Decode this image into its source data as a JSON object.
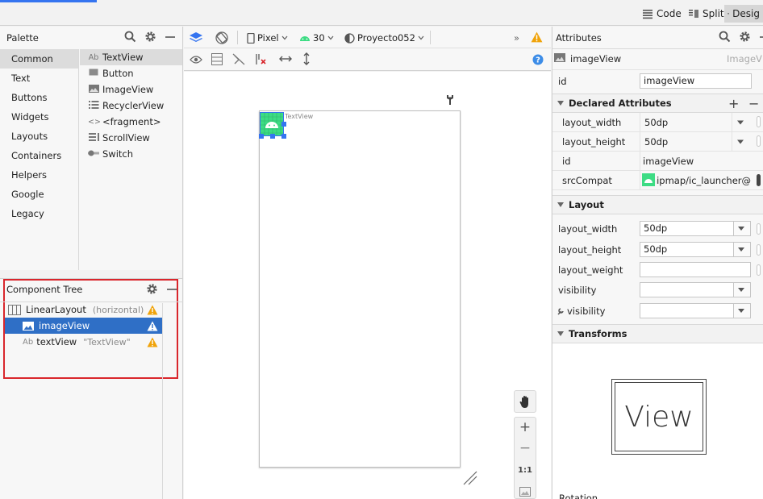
{
  "modes": {
    "code": "Code",
    "split": "Split",
    "design": "Desig"
  },
  "palette": {
    "title": "Palette",
    "categories": [
      "Common",
      "Text",
      "Buttons",
      "Widgets",
      "Layouts",
      "Containers",
      "Helpers",
      "Google",
      "Legacy"
    ],
    "items": [
      {
        "icon": "Ab",
        "label": "TextView"
      },
      {
        "icon": "btn",
        "label": "Button"
      },
      {
        "icon": "img",
        "label": "ImageView"
      },
      {
        "icon": "list",
        "label": "RecyclerView"
      },
      {
        "icon": "<>",
        "label": "<fragment>"
      },
      {
        "icon": "scroll",
        "label": "ScrollView"
      },
      {
        "icon": "switch",
        "label": "Switch"
      }
    ]
  },
  "component_tree": {
    "title": "Component Tree",
    "rows": [
      {
        "label": "LinearLayout",
        "hint": "(horizontal)"
      },
      {
        "label": "imageView",
        "hint": ""
      },
      {
        "icon": "Ab",
        "label": "textView",
        "hint": "\"TextView\""
      }
    ]
  },
  "design_toolbar": {
    "device": "Pixel",
    "api": "30",
    "theme": "Proyecto052",
    "overflow": "»"
  },
  "canvas": {
    "textview_label": "TextView",
    "zoom_reset": "1:1",
    "zoom_in": "+",
    "zoom_out": "−"
  },
  "attributes": {
    "title": "Attributes",
    "component_type": "imageView",
    "component_class": "ImageV",
    "id_label": "id",
    "id_value": "imageView",
    "declared_title": "Declared Attributes",
    "declared": [
      {
        "name": "layout_width",
        "value": "50dp"
      },
      {
        "name": "layout_height",
        "value": "50dp"
      },
      {
        "name": "id",
        "value": "imageView"
      },
      {
        "name": "srcCompat",
        "value": "@mipmap/ic_launcher"
      }
    ],
    "layout_title": "Layout",
    "layout": [
      {
        "name": "layout_width",
        "value": "50dp"
      },
      {
        "name": "layout_height",
        "value": "50dp"
      },
      {
        "name": "layout_weight",
        "value": ""
      },
      {
        "name": "visibility",
        "value": ""
      },
      {
        "name": "visibility",
        "value": ""
      }
    ],
    "transforms_title": "Transforms",
    "view_preview": "View",
    "rotation_label": "Rotation"
  },
  "colors": {
    "accent": "#3574f0",
    "selection": "#2f6fc6",
    "warning": "#f0a30a",
    "highlight_box": "#d9262c",
    "android_green": "#3ddc84"
  }
}
